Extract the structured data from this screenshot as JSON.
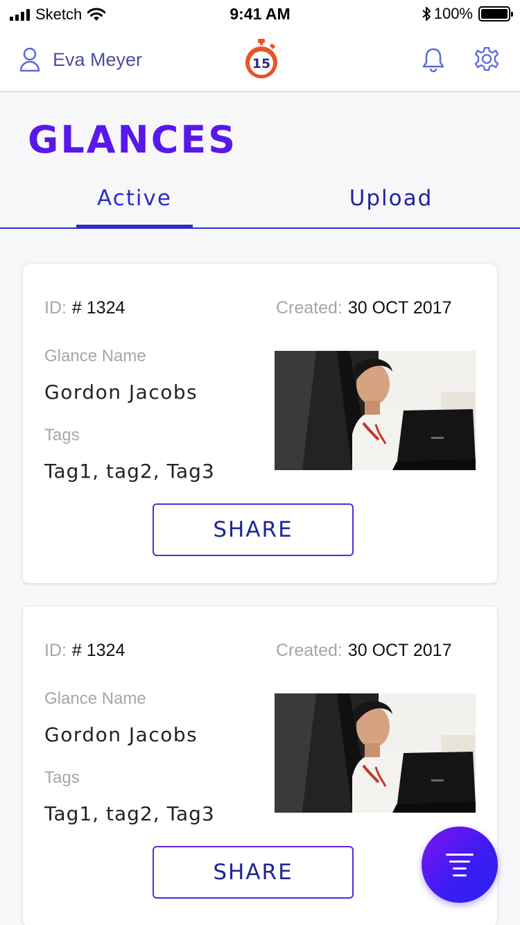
{
  "status_bar": {
    "carrier": "Sketch",
    "time": "9:41 AM",
    "battery": "100%"
  },
  "header": {
    "user_name": "Eva Meyer",
    "logo_text": "15"
  },
  "page": {
    "title": "GLANCES"
  },
  "tabs": [
    {
      "label": "Active",
      "selected": true
    },
    {
      "label": "Upload",
      "selected": false
    }
  ],
  "cards": [
    {
      "id_label": "ID:",
      "id_value": "# 1324",
      "created_label": "Created:",
      "created_value": "30 OCT 2017",
      "name_label": "Glance Name",
      "name_value": "Gordon Jacobs",
      "tags_label": "Tags",
      "tags_value": "Tag1, tag2, Tag3",
      "share_label": "SHARE"
    },
    {
      "id_label": "ID:",
      "id_value": "# 1324",
      "created_label": "Created:",
      "created_value": "30 OCT 2017",
      "name_label": "Glance Name",
      "name_value": "Gordon Jacobs",
      "tags_label": "Tags",
      "tags_value": "Tag1, tag2, Tag3",
      "share_label": "SHARE"
    }
  ],
  "icons": {
    "user": "user-icon",
    "bell": "bell-icon",
    "settings": "gear-icon",
    "fab": "filter-menu-icon"
  },
  "colors": {
    "accent": "#5a17ea",
    "tab": "#2b2fc4",
    "header_text": "#4b4d9c",
    "logo": "#e8542a"
  }
}
